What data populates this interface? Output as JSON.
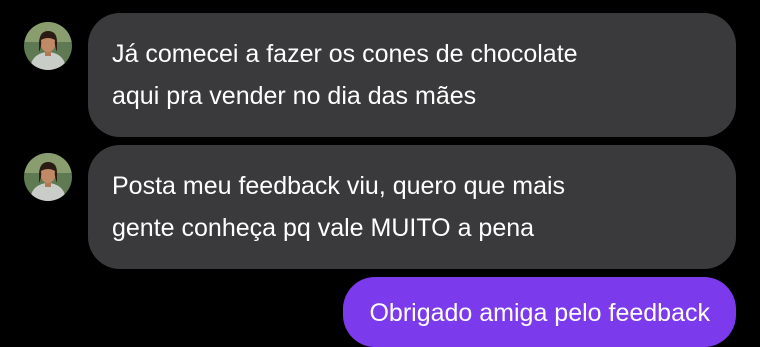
{
  "colors": {
    "background": "#000000",
    "received_bubble": "#3a3a3c",
    "sent_bubble": "#7c3aed",
    "text": "#ffffff"
  },
  "messages": [
    {
      "sender": "contact",
      "avatar_icon": "contact-avatar-icon",
      "lines": [
        "Já comecei a fazer os cones de chocolate",
        "aqui pra vender no dia das mães"
      ]
    },
    {
      "sender": "contact",
      "avatar_icon": "contact-avatar-icon",
      "lines": [
        "Posta meu feedback viu, quero que mais",
        "gente conheça pq vale MUITO a pena"
      ]
    },
    {
      "sender": "me",
      "lines": [
        "Obrigado amiga pelo feedback"
      ]
    }
  ]
}
